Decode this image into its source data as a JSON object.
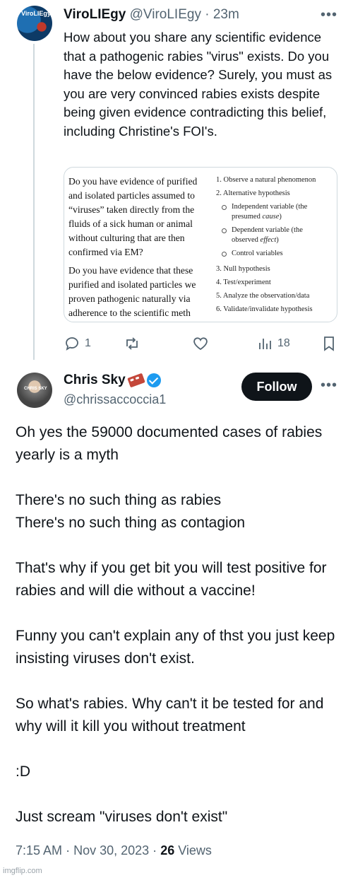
{
  "tweet1": {
    "name": "ViroLIEgy",
    "handle": "@ViroLIEgy",
    "separator": "·",
    "time": "23m",
    "avatar_text": "ViroLIEgy",
    "text": "How about you share any scientific evidence that a pathogenic rabies \"virus\" exists. Do you have the below evidence? Surely, you must as you are very convinced rabies exists despite being given evidence contradicting this belief, including Christine's FOI's.",
    "media": {
      "left_para1": [
        "Do you have evidence of purified",
        "and isolated particles assumed to",
        "“viruses” taken directly from the",
        "fluids of a sick human or animal",
        "without culturing that are then",
        "confirmed via EM?"
      ],
      "left_para2": [
        "Do you have evidence that these",
        "purified and isolated particles we",
        "proven pathogenic naturally via",
        "adherence to the scientific meth"
      ],
      "steps": {
        "s1": "1.  Observe a natural phenomenon",
        "s2": "2.  Alternative hypothesis",
        "sub1a": "Independent variable (the presumed ",
        "sub1b": "cause",
        "sub1c": ")",
        "sub2a": "Dependent variable (the observed ",
        "sub2b": "effect",
        "sub2c": ")",
        "sub3": "Control variables",
        "s3": "3.  Null hypothesis",
        "s4": "4.  Test/experiment",
        "s5": "5.  Analyze the observation/data",
        "s6": "6.  Validate/invalidate hypothesis"
      }
    },
    "actions": {
      "replies": "1",
      "retweets": "",
      "likes": "",
      "views": "18"
    }
  },
  "tweet2": {
    "name": "Chris Sky",
    "handle": "@chrissaccoccia1",
    "avatar_text": "CHRIS SKY",
    "follow_label": "Follow",
    "paragraphs": [
      "Oh yes the 59000 documented cases of rabies yearly is a myth",
      "There's no such thing as rabies\nThere's no such thing as contagion",
      "That's why if you get bit you will test positive for rabies and will die without a vaccine!",
      "Funny you can't explain any of thst you just keep insisting viruses don't exist.",
      "So what's rabies. Why can't it be tested for and why will it kill you without treatment",
      ":D",
      "Just scream \"viruses don't exist\""
    ],
    "time": "7:15 AM",
    "date": "Nov 30, 2023",
    "views_count": "26",
    "views_label": "Views",
    "separator": "·"
  },
  "watermark": "imgflip.com",
  "colors": {
    "text": "#0f1419",
    "secondary": "#536471",
    "verified": "#1d9bf0",
    "border": "#cfd9de"
  },
  "icons": {
    "more": "more-horizontal-icon",
    "reply": "reply-icon",
    "retweet": "retweet-icon",
    "like": "heart-icon",
    "views": "views-chart-icon",
    "bookmark": "bookmark-icon",
    "verified": "verified-badge-icon",
    "brick": "brick-emoji-icon"
  }
}
